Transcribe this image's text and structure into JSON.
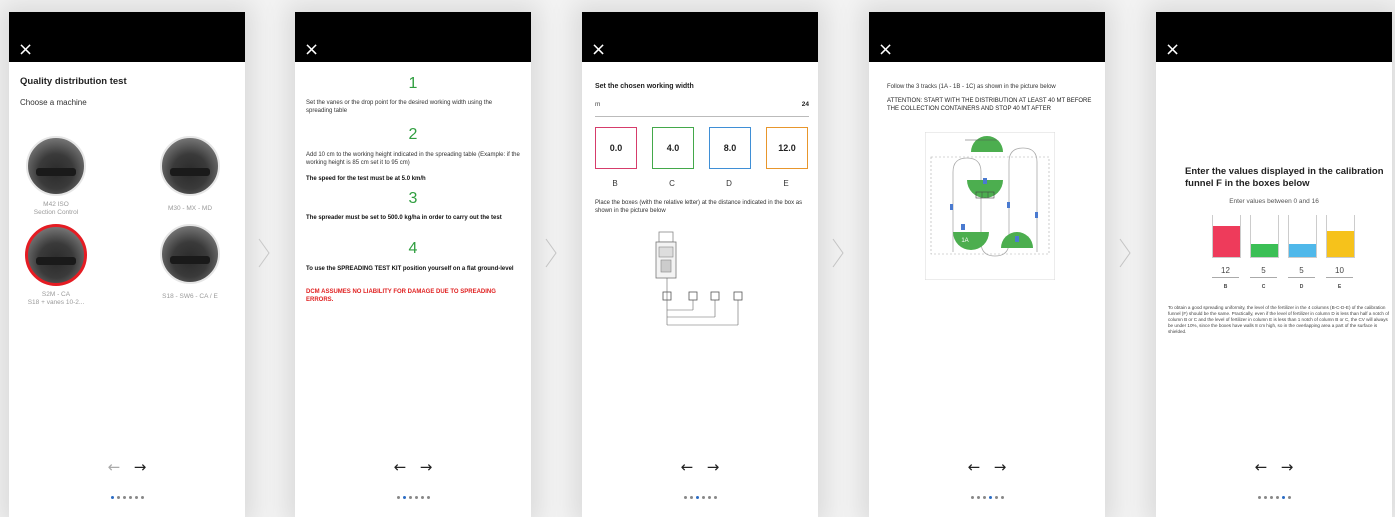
{
  "common": {
    "close_icon": "×",
    "prev_arrow": "←",
    "next_arrow": "→"
  },
  "screen1": {
    "title": "Quality distribution test",
    "subtitle": "Choose a machine",
    "machines": [
      {
        "line1": "M42 ISO",
        "line2": "Section Control",
        "selected": false
      },
      {
        "line1": "M30 - MX - MD",
        "line2": "",
        "selected": false
      },
      {
        "line1": "S2M - CA",
        "line2": "S18 + vanes 10-2...",
        "selected": true
      },
      {
        "line1": "S18 - SW6 - CA / E",
        "line2": "",
        "selected": false
      }
    ]
  },
  "screen2": {
    "steps": [
      {
        "num": "1",
        "text": "Set the vanes or the drop point for the desired working width using the spreading table"
      },
      {
        "num": "2",
        "text": "Add 10 cm to the working height indicated in the spreading table (Example: if the working height is 85 cm set it to 95 cm)",
        "bold": "The speed for the test must be at 5.0 km/h"
      },
      {
        "num": "3",
        "bold": "The spreader must be set to 500.0 kg/ha in order to carry out the test"
      },
      {
        "num": "4",
        "bold": "To use the SPREADING TEST KIT position yourself on a flat ground-level"
      }
    ],
    "warning": "DCM ASSUMES NO LIABILITY FOR DAMAGE DUE TO SPREADING ERRORS."
  },
  "screen3": {
    "title": "Set the chosen working width",
    "unit": "m",
    "width_value": "24",
    "boxes": [
      {
        "value": "0.0",
        "letter": "B",
        "color": "#d63c6b"
      },
      {
        "value": "4.0",
        "letter": "C",
        "color": "#43a84a"
      },
      {
        "value": "8.0",
        "letter": "D",
        "color": "#3f8fd6"
      },
      {
        "value": "12.0",
        "letter": "E",
        "color": "#e8962c"
      }
    ],
    "instruction": "Place the boxes (with the relative letter) at the distance indicated in the box as shown in the picture below"
  },
  "screen4": {
    "intro": "Follow the 3 tracks (1A - 1B - 1C) as shown in the picture below",
    "attention": "ATTENTION: START WITH THE DISTRIBUTION AT LEAST 40 MT BEFORE THE COLLECTION CONTAINERS AND STOP 40 MT AFTER",
    "labels": {
      "a": "1A",
      "b": "1B",
      "c": "1C"
    }
  },
  "screen5": {
    "heading": "Enter the values displayed in the calibration funnel F in the boxes below",
    "hint": "Enter values between 0 and 16",
    "columns": [
      {
        "value": "12",
        "letter": "B",
        "color": "#ee3b5b",
        "level": 0.75
      },
      {
        "value": "5",
        "letter": "C",
        "color": "#3bbf55",
        "level": 0.31
      },
      {
        "value": "5",
        "letter": "D",
        "color": "#4fb8ea",
        "level": 0.31
      },
      {
        "value": "10",
        "letter": "E",
        "color": "#f6c21b",
        "level": 0.62
      }
    ],
    "note": "To obtain a good spreading uniformity, the level of the fertilizer in the 4 columns (B-C-D-E) of the calibration funnel (F) should be the same. Practically, even if the level of fertilizer in column D is less than half a notch of column B or C and the level of fertilizer in column E is less than 1 notch of column B or C, the CV will always be under 10%, since the boxes have walls 8 cm high, so in the overlapping area a part of the surface is shielded."
  }
}
